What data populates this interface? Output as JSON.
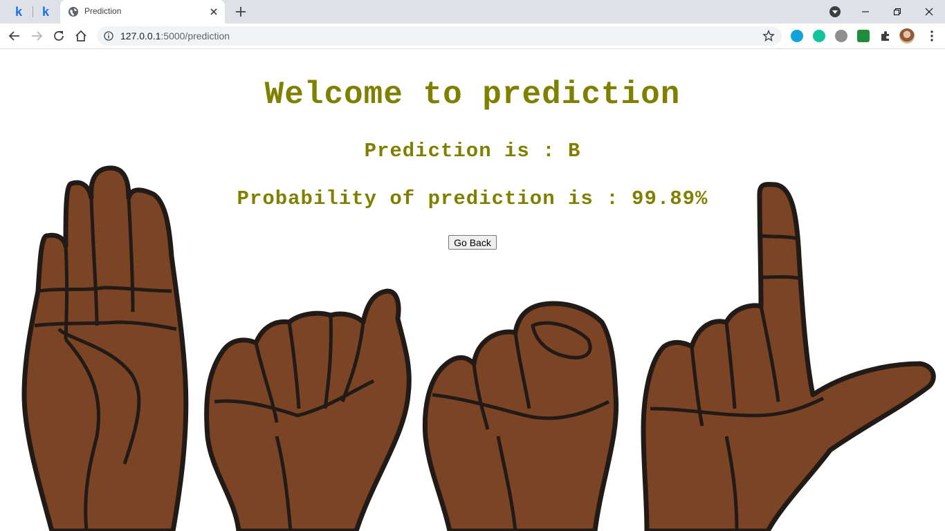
{
  "browser": {
    "pinned_tabs": [
      {
        "label": "k"
      },
      {
        "label": "k"
      }
    ],
    "active_tab": {
      "title": "Prediction"
    },
    "address_bar": {
      "host": "127.0.0.1",
      "path": ":5000/prediction"
    }
  },
  "page": {
    "heading": "Welcome to prediction",
    "prediction_text": "Prediction is : B",
    "probability_text": "Probability of prediction is : 99.89%",
    "go_back_label": "Go Back",
    "text_color": "#808000",
    "hand_color": "#7b4424"
  }
}
